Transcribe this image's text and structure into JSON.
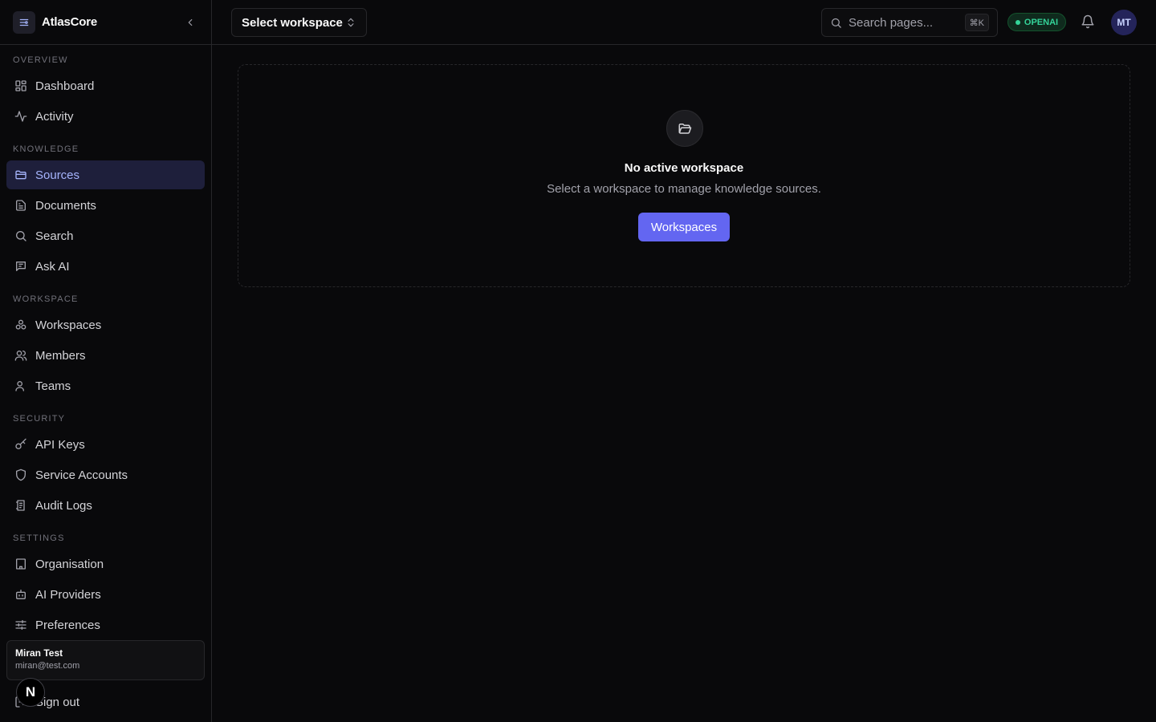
{
  "app": {
    "name": "AtlasCore"
  },
  "sidebar": {
    "sections": [
      {
        "title": "OVERVIEW",
        "items": [
          {
            "label": "Dashboard",
            "icon": "dashboard-icon"
          },
          {
            "label": "Activity",
            "icon": "activity-icon"
          }
        ]
      },
      {
        "title": "KNOWLEDGE",
        "items": [
          {
            "label": "Sources",
            "icon": "folder-icon",
            "active": true
          },
          {
            "label": "Documents",
            "icon": "document-icon"
          },
          {
            "label": "Search",
            "icon": "search-icon"
          },
          {
            "label": "Ask AI",
            "icon": "chat-icon"
          }
        ]
      },
      {
        "title": "WORKSPACE",
        "items": [
          {
            "label": "Workspaces",
            "icon": "workspaces-icon"
          },
          {
            "label": "Members",
            "icon": "users-icon"
          },
          {
            "label": "Teams",
            "icon": "user-icon"
          }
        ]
      },
      {
        "title": "SECURITY",
        "items": [
          {
            "label": "API Keys",
            "icon": "key-icon"
          },
          {
            "label": "Service Accounts",
            "icon": "shield-icon"
          },
          {
            "label": "Audit Logs",
            "icon": "logs-icon"
          }
        ]
      },
      {
        "title": "SETTINGS",
        "items": [
          {
            "label": "Organisation",
            "icon": "building-icon"
          },
          {
            "label": "AI Providers",
            "icon": "bot-icon"
          },
          {
            "label": "Preferences",
            "icon": "sliders-icon"
          }
        ]
      }
    ],
    "user": {
      "name": "Miran Test",
      "email": "miran@test.com"
    },
    "signout_label": "Sign out",
    "floating_badge": "N"
  },
  "topbar": {
    "workspace_select": "Select workspace",
    "search_placeholder": "Search pages...",
    "search_shortcut": "⌘K",
    "provider_badge": "OPENAI",
    "avatar_initials": "MT"
  },
  "main": {
    "empty_title": "No active workspace",
    "empty_description": "Select a workspace to manage knowledge sources.",
    "cta_label": "Workspaces"
  },
  "colors": {
    "background": "#09090b",
    "accent": "#6366f1",
    "active_nav_bg": "#1e1f3b",
    "status_green": "#34d399"
  }
}
